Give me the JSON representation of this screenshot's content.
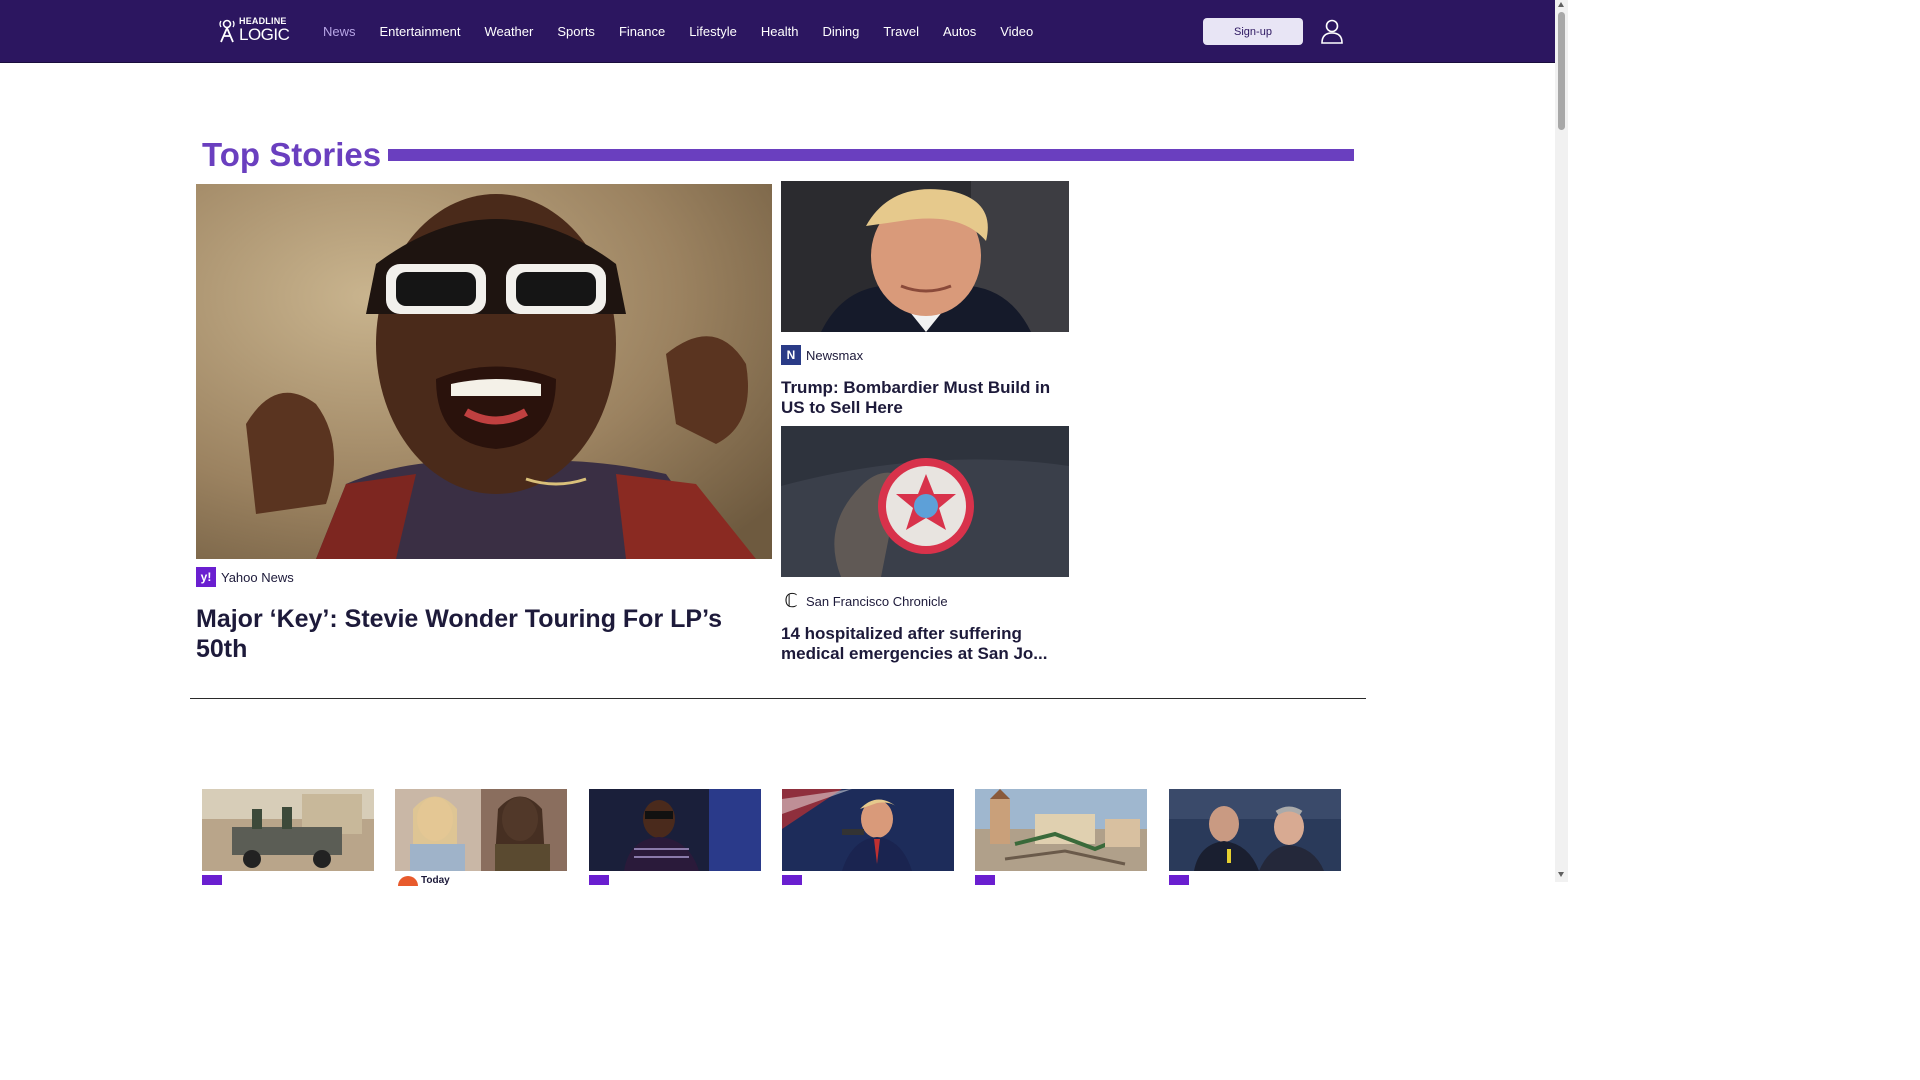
{
  "header": {
    "logo_line1": "HEADLINE",
    "logo_line2": "LOGIC",
    "nav": [
      {
        "label": "News",
        "active": true
      },
      {
        "label": "Entertainment"
      },
      {
        "label": "Weather"
      },
      {
        "label": "Sports"
      },
      {
        "label": "Finance"
      },
      {
        "label": "Lifestyle"
      },
      {
        "label": "Health"
      },
      {
        "label": "Dining"
      },
      {
        "label": "Travel"
      },
      {
        "label": "Autos"
      },
      {
        "label": "Video"
      }
    ],
    "signup_label": "Sign-up",
    "user_icon": "user-icon"
  },
  "top_stories": {
    "title": "Top Stories",
    "main": {
      "source": "Yahoo News",
      "source_badge": "y!",
      "headline": "Major ‘Key’: Stevie Wonder Touring For LP’s 50th"
    },
    "side": [
      {
        "source": "Newsmax",
        "source_badge": "N",
        "headline": "Trump: Bombardier Must Build in US to Sell Here"
      },
      {
        "source": "San Francisco Chronicle",
        "source_badge": "ℂ",
        "headline": "14 hospitalized after suffering medical emergencies at San Jo..."
      }
    ]
  },
  "more_stories": {
    "items": [
      {
        "source": ""
      },
      {
        "source": "Today"
      },
      {
        "source": ""
      },
      {
        "source": ""
      },
      {
        "source": ""
      },
      {
        "source": ""
      }
    ]
  },
  "colors": {
    "header_bg": "#2c1660",
    "accent": "#6a3fbf",
    "yahoo_badge": "#6a1fd0",
    "newsmax_badge": "#2a3b87"
  }
}
